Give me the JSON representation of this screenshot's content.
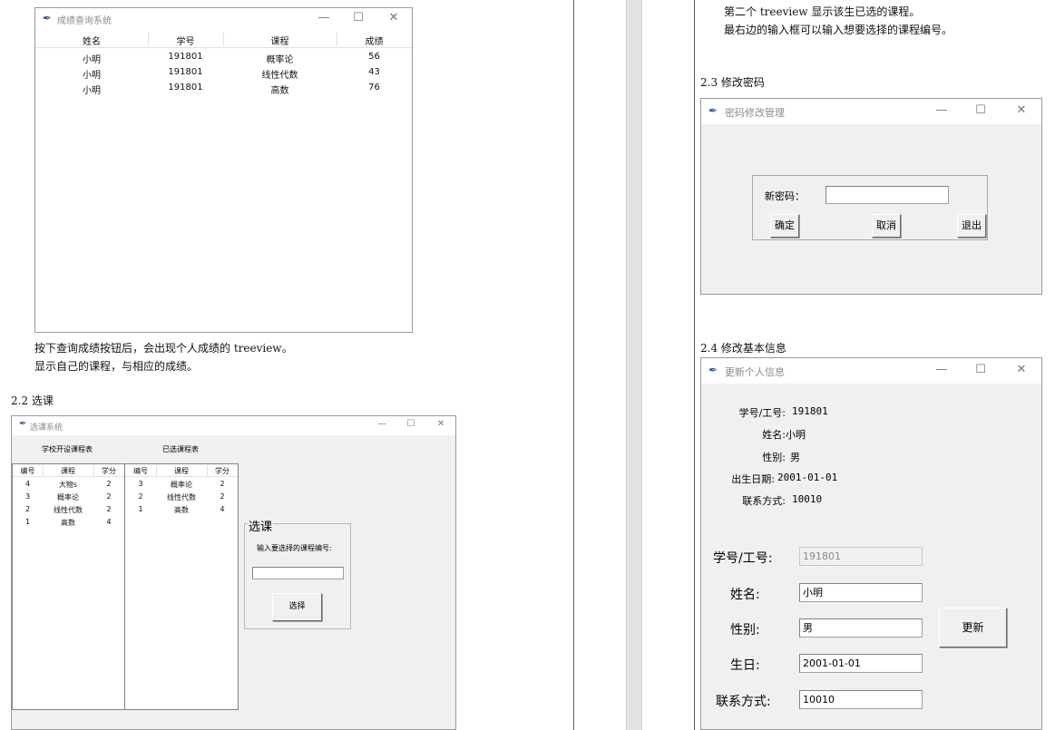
{
  "grade_window": {
    "title": "成绩查询系统",
    "controls": {
      "minimize": "—",
      "maximize": "☐",
      "close": "✕"
    },
    "columns": [
      "姓名",
      "学号",
      "课程",
      "成绩"
    ],
    "rows": [
      [
        "小明",
        "191801",
        "概率论",
        "56"
      ],
      [
        "小明",
        "191801",
        "线性代数",
        "43"
      ],
      [
        "小明",
        "191801",
        "高数",
        "76"
      ]
    ]
  },
  "doc_left": {
    "para1": "按下查询成绩按钮后，会出现个人成绩的 treeview。",
    "para2": "显示自己的课程，与相应的成绩。",
    "section_22": "2.2  选课"
  },
  "course_window": {
    "title": "选课系统",
    "controls": {
      "minimize": "—",
      "maximize": "☐",
      "close": "✕"
    },
    "offered_label": "学校开设课程表",
    "selected_label": "已选课程表",
    "offered_columns": [
      "编号",
      "课程",
      "学分"
    ],
    "offered_rows": [
      [
        "4",
        "大物s",
        "2"
      ],
      [
        "3",
        "概率论",
        "2"
      ],
      [
        "2",
        "线性代数",
        "2"
      ],
      [
        "1",
        "高数",
        "4"
      ]
    ],
    "selected_columns": [
      "编号",
      "课程",
      "学分"
    ],
    "selected_rows": [
      [
        "3",
        "概率论",
        "2"
      ],
      [
        "2",
        "线性代数",
        "2"
      ],
      [
        "1",
        "高数",
        "4"
      ]
    ],
    "group_title": "选课",
    "prompt": "输入要选择的课程编号:",
    "input_value": "",
    "select_button": "选择"
  },
  "doc_right": {
    "line1": "第二个 treeview 显示该生已选的课程。",
    "line2": "最右边的输入框可以输入想要选择的课程编号。",
    "section_23": "2.3  修改密码",
    "section_24": "2.4  修改基本信息"
  },
  "password_window": {
    "title": "密码修改管理",
    "controls": {
      "minimize": "—",
      "maximize": "☐",
      "close": "✕"
    },
    "label": "新密码：",
    "input_value": "",
    "confirm": "确定",
    "cancel": "取消",
    "exit": "退出"
  },
  "info_window": {
    "title": "更新个人信息",
    "controls": {
      "minimize": "—",
      "maximize": "☐",
      "close": "✕"
    },
    "display": [
      {
        "label": "学号/工号:",
        "value": "191801"
      },
      {
        "label": "姓名:",
        "value": "小明"
      },
      {
        "label": "性别:",
        "value": "男"
      },
      {
        "label": "出生日期:",
        "value": "2001-01-01"
      },
      {
        "label": "联系方式:",
        "value": "10010"
      }
    ],
    "form": [
      {
        "label": "学号/工号:",
        "value": "191801"
      },
      {
        "label": "姓名:",
        "value": "小明"
      },
      {
        "label": "性别:",
        "value": "男"
      },
      {
        "label": "生日:",
        "value": "2001-01-01"
      },
      {
        "label": "联系方式:",
        "value": "10010"
      }
    ],
    "update_button": "更新"
  }
}
